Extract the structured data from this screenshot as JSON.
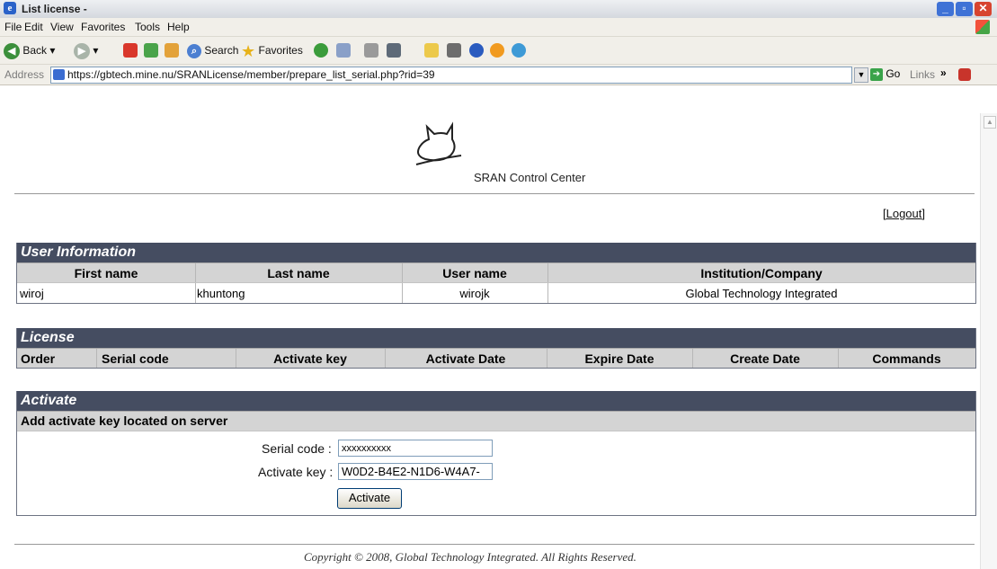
{
  "window": {
    "title": "List license -"
  },
  "menu": [
    "File",
    "Edit",
    "View",
    "Favorites",
    "Tools",
    "Help"
  ],
  "toolbar": {
    "back": "Back",
    "search": "Search",
    "favorites": "Favorites"
  },
  "address": {
    "label": "Address",
    "url": "https://gbtech.mine.nu/SRANLicense/member/prepare_list_serial.php?rid=39",
    "go": "Go",
    "links": "Links",
    "chevron": "»"
  },
  "header": {
    "app_name": "SRAN Control Center",
    "logout": "[Logout]"
  },
  "user_info": {
    "title": "User Information",
    "columns": [
      "First name",
      "Last name",
      "User name",
      "Institution/Company"
    ],
    "row": [
      "wiroj",
      "khuntong",
      "wirojk",
      "Global Technology Integrated"
    ]
  },
  "license": {
    "title": "License",
    "columns": [
      "Order",
      "Serial code",
      "Activate key",
      "Activate Date",
      "Expire Date",
      "Create Date",
      "Commands"
    ]
  },
  "activate": {
    "title": "Activate",
    "subtitle": "Add activate key located on server",
    "serial_label": "Serial code :",
    "serial_value": "xxxxxxxxxx",
    "key_label": "Activate key :",
    "key_value": "W0D2-B4E2-N1D6-W4A7-",
    "button": "Activate"
  },
  "footer": {
    "copyright": "Copyright © 2008, Global Technology Integrated. All Rights Reserved."
  }
}
